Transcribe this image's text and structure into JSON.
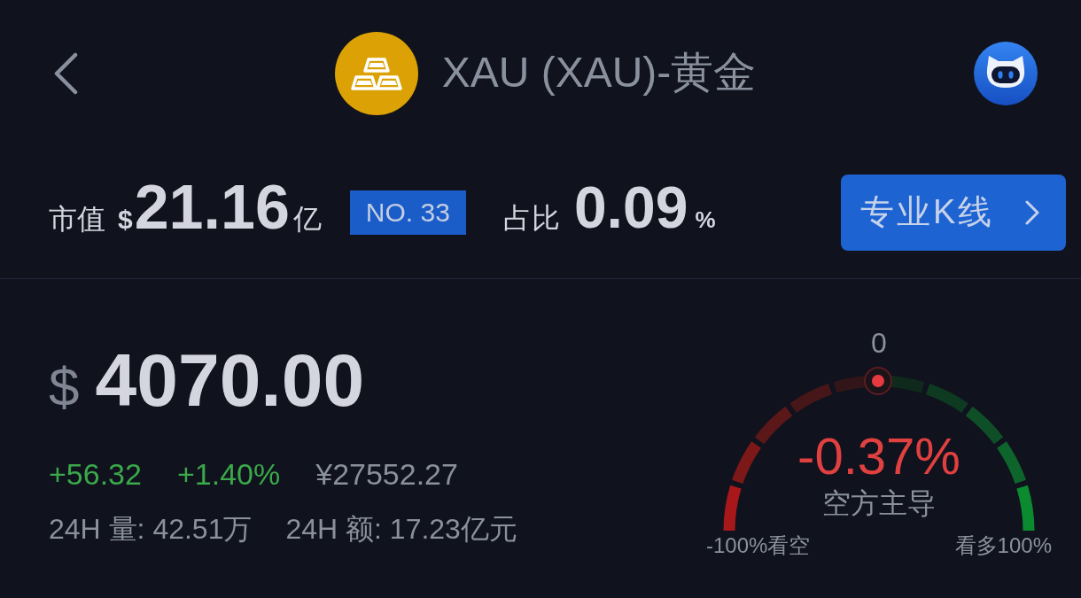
{
  "header": {
    "title": "XAU (XAU)-黄金"
  },
  "market": {
    "label": "市值",
    "currency": "$",
    "value": "21.16",
    "unit": "亿",
    "rank": "NO. 33",
    "share_label": "占比",
    "share_value": "0.09",
    "share_unit": "%",
    "kline_button": "专业K线"
  },
  "price": {
    "currency": "$",
    "value": "4070.00",
    "rising": true,
    "change": "+56.32",
    "change_percent": "+1.40%",
    "cny_price": "¥27552.27",
    "volume_24h": "24H 量: 42.51万",
    "turnover_24h": "24H 额: 17.23亿元"
  },
  "sentiment": {
    "center_label": "0",
    "rising": false,
    "reading": "-0.37%",
    "caption": "空方主导",
    "min_label": "-100%看空",
    "max_label": "看多100%",
    "level": 0.498
  }
}
